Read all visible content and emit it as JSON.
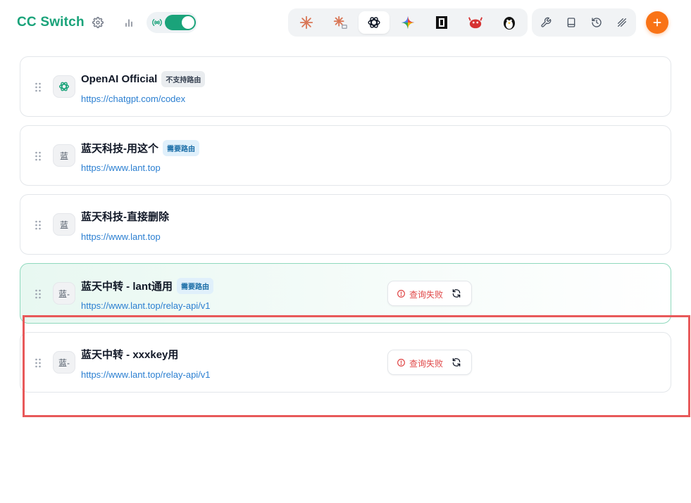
{
  "app": {
    "title": "CC Switch"
  },
  "header": {
    "settings_icon": "gear-icon",
    "stats_icon": "bar-chart-icon",
    "proxy_toggle": {
      "icon": "broadcast-icon",
      "on": true,
      "accent": "#1aa37a"
    },
    "apps": [
      {
        "name": "claude-icon",
        "active": false
      },
      {
        "name": "claude-desktop-icon",
        "active": false
      },
      {
        "name": "openai-icon",
        "active": true
      },
      {
        "name": "gemini-icon",
        "active": false
      },
      {
        "name": "opencode-icon",
        "active": false
      },
      {
        "name": "red-mascot-icon",
        "active": false
      },
      {
        "name": "penguin-icon",
        "active": false
      }
    ],
    "tools": [
      "wrench-icon",
      "book-icon",
      "history-icon",
      "skills-icon"
    ],
    "add_button": {
      "icon": "plus-icon",
      "color": "#f97316"
    }
  },
  "providers": [
    {
      "name": "OpenAI Official",
      "badge": "不支持路由",
      "badge_style": "gray",
      "url": "https://chatgpt.com/codex",
      "avatar": "",
      "avatar_icon": "openai-icon",
      "current": false,
      "status": ""
    },
    {
      "name": "蓝天科技-用这个",
      "badge": "需要路由",
      "badge_style": "blue",
      "url": "https://www.lant.top",
      "avatar": "蓝",
      "current": false,
      "status": ""
    },
    {
      "name": "蓝天科技-直接删除",
      "badge": "",
      "badge_style": "",
      "url": "https://www.lant.top",
      "avatar": "蓝",
      "current": false,
      "status": ""
    },
    {
      "name": "蓝天中转 - lant通用",
      "badge": "需要路由",
      "badge_style": "blue",
      "url": "https://www.lant.top/relay-api/v1",
      "avatar": "蓝-",
      "current": true,
      "status": "查询失败"
    },
    {
      "name": "蓝天中转 - xxxkey用",
      "badge": "",
      "badge_style": "",
      "url": "https://www.lant.top/relay-api/v1",
      "avatar": "蓝-",
      "current": false,
      "status": "查询失败"
    }
  ],
  "colors": {
    "brand": "#1aa37a",
    "link": "#2b7fd1",
    "error": "#e04848",
    "highlight": "#e8595a"
  }
}
